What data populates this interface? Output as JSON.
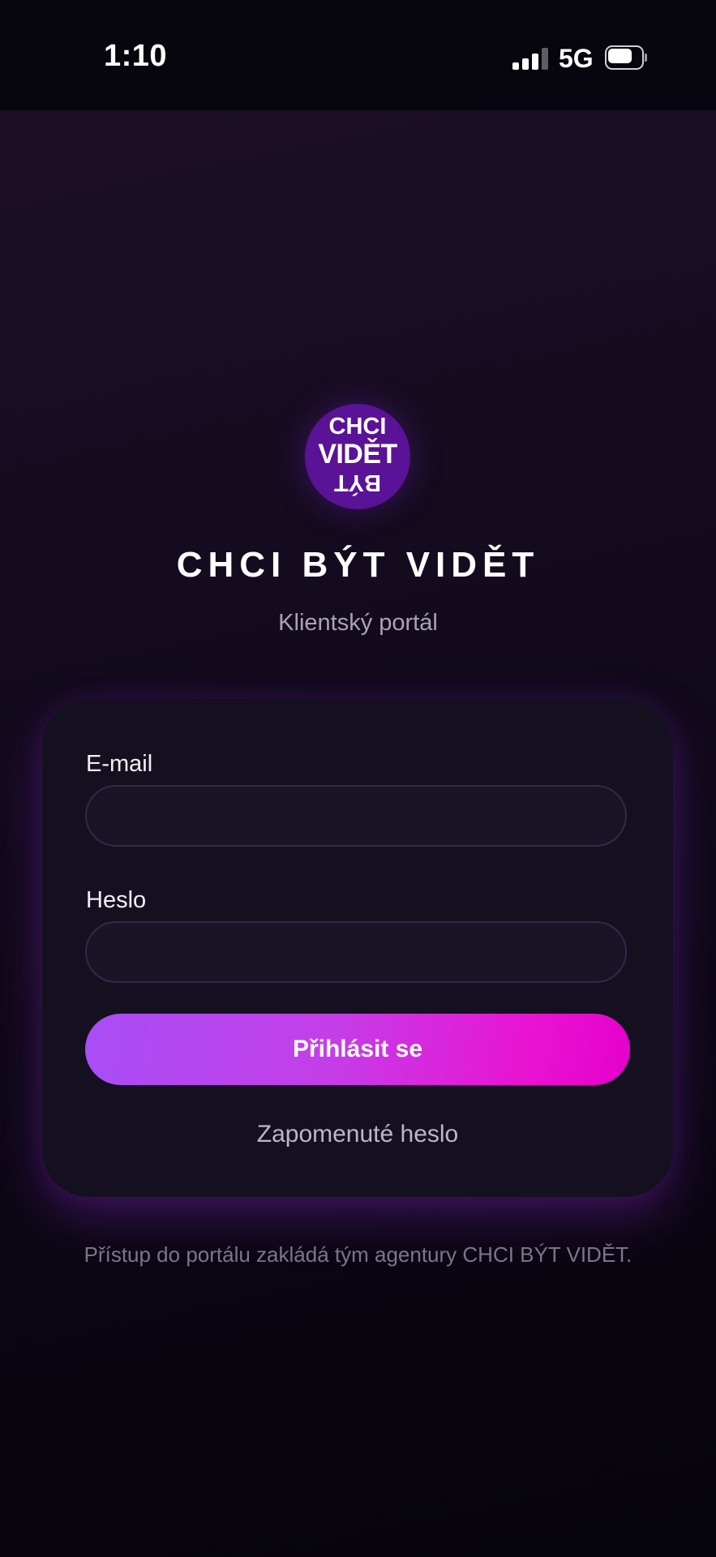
{
  "status_bar": {
    "time": "1:10",
    "network": "5G",
    "signal_bars_active": 3,
    "signal_bars_total": 4,
    "battery_level": 0.8
  },
  "logo": {
    "line_1": "CHCI",
    "line_2": "VIDĚT",
    "line_3": "BÝT",
    "color": "#5a1296"
  },
  "brand": {
    "title": "CHCI BÝT VIDĚT",
    "subtitle": "Klientský portál"
  },
  "login_form": {
    "email_label": "E-mail",
    "email_value": "",
    "email_placeholder": "",
    "password_label": "Heslo",
    "password_value": "",
    "password_placeholder": "",
    "submit_label": "Přihlásit se",
    "forgot_password_label": "Zapomenuté heslo"
  },
  "footer": {
    "note": "Přístup do portálu zakládá tým agentury CHCI BÝT VIDĚT."
  },
  "colors": {
    "accent_start": "#a84ef5",
    "accent_end": "#e600cc",
    "background": "#120a1c"
  },
  "icons": {
    "signal": "cellular-signal-icon",
    "battery": "battery-icon"
  }
}
